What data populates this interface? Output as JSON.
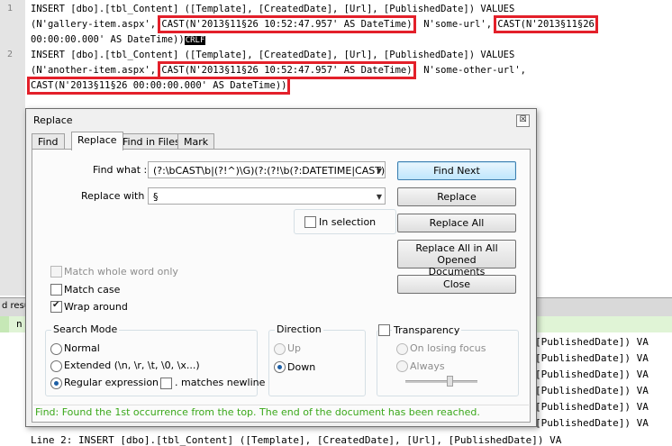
{
  "editor": {
    "line_numbers": [
      "1",
      "2"
    ],
    "line1": {
      "part_a": "INSERT [dbo].[tbl_Content] ([Template], [CreatedDate], [Url], [PublishedDate]) VALUES",
      "part_b": "(N'gallery-item.aspx', ",
      "cast1": "CAST(N'2013§11§26 10:52:47.957' AS DateTime)",
      "part_c": ", N'some-url', ",
      "cast2a": "CAST(N'2013§11§26",
      "cast2b": "00:00:00.000' AS DateTime)",
      "part_d": ")",
      "crlf": "CRLF"
    },
    "line2": {
      "part_a": "INSERT [dbo].[tbl_Content] ([Template], [CreatedDate], [Url], [PublishedDate]) VALUES",
      "part_b": "(N'another-item.aspx', ",
      "cast1": "CAST(N'2013§11§26 10:52:47.957' AS DateTime)",
      "part_c": ", N'some-other-url',",
      "cast2": "CAST(N'2013§11§26 00:00:00.000' AS DateTime))"
    }
  },
  "results_panel": {
    "tab_label": "d resu",
    "first_line_prefix": "n",
    "lines": [
      "[PublishedDate]) VA",
      "[PublishedDate]) VA",
      "[PublishedDate]) VA",
      "[PublishedDate]) VA",
      "[PublishedDate]) VA",
      "[PublishedDate]) VA"
    ],
    "bottom_line": "Line 2: INSERT [dbo].[tbl_Content] ([Template], [CreatedDate], [Url], [PublishedDate]) VA"
  },
  "dialog": {
    "title": "Replace",
    "close_glyph": "☒",
    "tabs": [
      "Find",
      "Replace",
      "Find in Files",
      "Mark"
    ],
    "find_label": "Find what :",
    "find_value": "(?:\\bCAST\\b|(?!^)\\G)(?:(?!\\b(?:DATETIME|CAST)\\b",
    "replace_label": "Replace with :",
    "replace_value": "§",
    "in_selection_label": "In selection",
    "buttons": {
      "find_next": "Find Next",
      "replace": "Replace",
      "replace_all": "Replace All",
      "replace_all_opened_1": "Replace All in All Opened",
      "replace_all_opened_2": "Documents",
      "close": "Close"
    },
    "options": {
      "match_whole_word": "Match whole word only",
      "match_case": "Match case",
      "wrap_around": "Wrap around"
    },
    "search_mode": {
      "title": "Search Mode",
      "normal": "Normal",
      "extended": "Extended (\\n, \\r, \\t, \\0, \\x...)",
      "regex": "Regular expression",
      "matches_newline": ". matches newline"
    },
    "direction": {
      "title": "Direction",
      "up": "Up",
      "down": "Down"
    },
    "transparency": {
      "title": "Transparency",
      "on_losing_focus": "On losing focus",
      "always": "Always"
    },
    "status": "Find: Found the 1st occurrence from the top. The end of the document has been reached."
  }
}
